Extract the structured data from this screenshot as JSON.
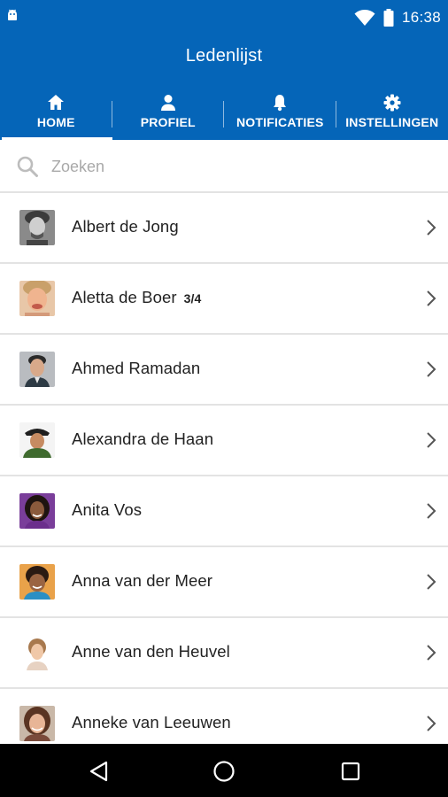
{
  "status_bar": {
    "time": "16:38",
    "icons": [
      "android-icon",
      "wifi-icon",
      "battery-icon"
    ]
  },
  "app_bar": {
    "title": "Ledenlijst"
  },
  "tabs": [
    {
      "label": "HOME",
      "icon": "home-icon",
      "active": true
    },
    {
      "label": "PROFIEL",
      "icon": "person-icon",
      "active": false
    },
    {
      "label": "NOTIFICATIES",
      "icon": "bell-icon",
      "active": false
    },
    {
      "label": "INSTELLINGEN",
      "icon": "gear-icon",
      "active": false
    }
  ],
  "search": {
    "placeholder": "Zoeken",
    "value": ""
  },
  "members": [
    {
      "name": "Albert de Jong",
      "badge": ""
    },
    {
      "name": "Aletta de Boer",
      "badge": "3/4"
    },
    {
      "name": "Ahmed Ramadan",
      "badge": ""
    },
    {
      "name": "Alexandra de Haan",
      "badge": ""
    },
    {
      "name": "Anita Vos",
      "badge": ""
    },
    {
      "name": "Anna van der Meer",
      "badge": ""
    },
    {
      "name": "Anne van den Heuvel",
      "badge": ""
    },
    {
      "name": "Anneke van Leeuwen",
      "badge": ""
    }
  ],
  "nav_bar": {
    "buttons": [
      "back-icon",
      "home-circle-icon",
      "recents-icon"
    ]
  },
  "colors": {
    "primary": "#0565b8",
    "divider": "#e3e3e3"
  }
}
